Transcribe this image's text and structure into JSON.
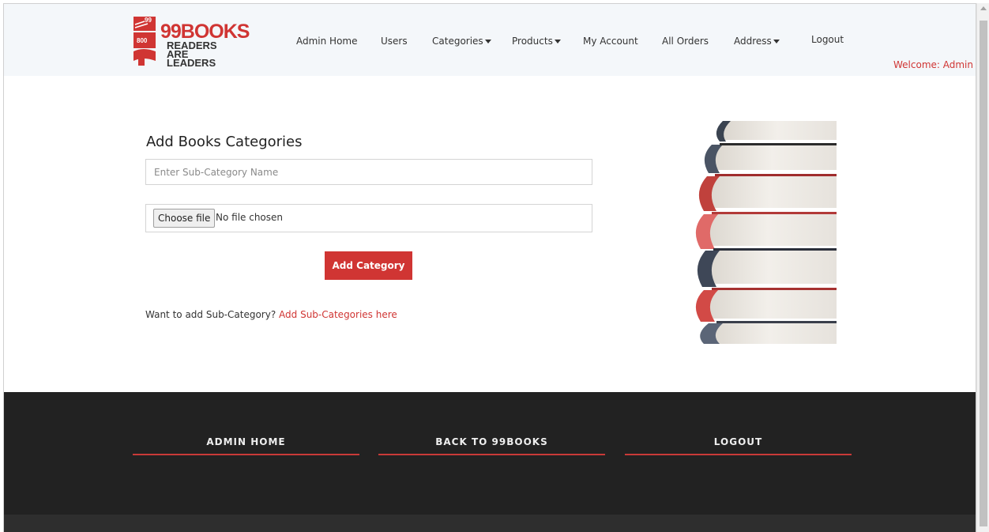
{
  "brand": {
    "logo_numbers": [
      "99",
      "800"
    ],
    "name": "99BOOKS",
    "tagline": "READERS ARE LEADERS"
  },
  "nav": {
    "items": [
      {
        "label": "Admin Home",
        "has_dropdown": false
      },
      {
        "label": "Users",
        "has_dropdown": false
      },
      {
        "label": "Categories",
        "has_dropdown": true
      },
      {
        "label": "Products",
        "has_dropdown": true
      },
      {
        "label": "My Account",
        "has_dropdown": false
      },
      {
        "label": "All Orders",
        "has_dropdown": false
      },
      {
        "label": "Address",
        "has_dropdown": true
      },
      {
        "label": "Logout",
        "has_dropdown": false
      }
    ],
    "welcome": "Welcome: Admin"
  },
  "form": {
    "title": "Add Books Categories",
    "name_placeholder": "Enter Sub-Category Name",
    "file_button": "Choose file",
    "file_status": "No file chosen",
    "submit_label": "Add Category",
    "hint_text": "Want to add Sub-Category?",
    "hint_link": "Add Sub-Categories here"
  },
  "footer": {
    "links": [
      "ADMIN HOME",
      "BACK TO 99BOOKS",
      "LOGOUT"
    ]
  },
  "colors": {
    "accent": "#d03533",
    "header_bg": "#f4f7fa",
    "footer_bg": "#222222"
  }
}
